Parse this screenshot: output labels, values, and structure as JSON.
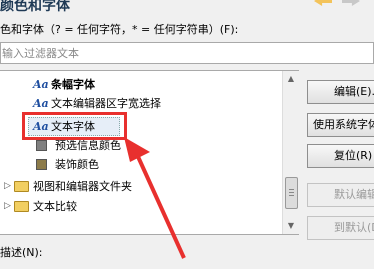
{
  "window": {
    "title": "颜色和字体",
    "hint": "色和字体（? = 任何字符，* = 任何字符串）(F):",
    "filter_placeholder": "输入过滤器文本"
  },
  "tree": {
    "items": [
      {
        "label": "条幅字体",
        "kind": "font"
      },
      {
        "label": "文本编辑器区字宽选择",
        "kind": "font"
      },
      {
        "label": "文本字体",
        "kind": "font",
        "selected": true
      },
      {
        "label": "预选信息颜色",
        "kind": "color",
        "swatch": "#808080"
      },
      {
        "label": "装饰颜色",
        "kind": "color",
        "swatch": "#8c7b4a"
      },
      {
        "label": "视图和编辑器文件夹",
        "kind": "folder"
      },
      {
        "label": "文本比较",
        "kind": "folder"
      }
    ]
  },
  "buttons": {
    "edit": "编辑(E)...",
    "use_system_font": "使用系统字体",
    "reset": "复位(R)",
    "edit_default": "默认编辑(",
    "go_to_default": "到默认(D)"
  },
  "description_label": "描述(N):",
  "colors": {
    "annotation": "#e8302e",
    "font_icon": "#1f4fa0"
  }
}
